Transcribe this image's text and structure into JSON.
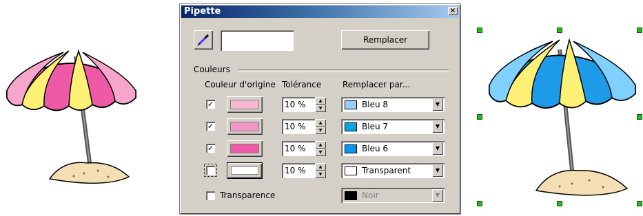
{
  "dialog": {
    "title": "Pipette",
    "close_glyph": "×",
    "replace_label": "Remplacer",
    "group_label": "Couleurs",
    "headers": {
      "source": "Couleur d'origine",
      "tolerance": "Tolérance",
      "replace_with": "Remplacer par..."
    },
    "rows": [
      {
        "checked": true,
        "source_color": "#f7b8d0",
        "tolerance": "10 %",
        "target_label": "Bleu 8",
        "target_color": "#99ccff"
      },
      {
        "checked": true,
        "source_color": "#f497c4",
        "tolerance": "10 %",
        "target_label": "Bleu 7",
        "target_color": "#00a8e8"
      },
      {
        "checked": true,
        "source_color": "#ee5aa6",
        "tolerance": "10 %",
        "target_label": "Bleu 6",
        "target_color": "#0094ff"
      },
      {
        "checked": false,
        "source_color": "#ffffff",
        "tolerance": "10 %",
        "target_label": "Transparent",
        "target_color": "#ffffff"
      }
    ],
    "transparency": {
      "label": "Transparence",
      "checked": false,
      "target_label": "Noir",
      "target_color": "#000000"
    }
  },
  "colors": {
    "pink": "#ee5aa6",
    "light_pink": "#f7a6cb",
    "yellow": "#fff176",
    "blue": "#1e9be8",
    "light_blue": "#7fd0ff",
    "sand": "#f3dfb3"
  }
}
